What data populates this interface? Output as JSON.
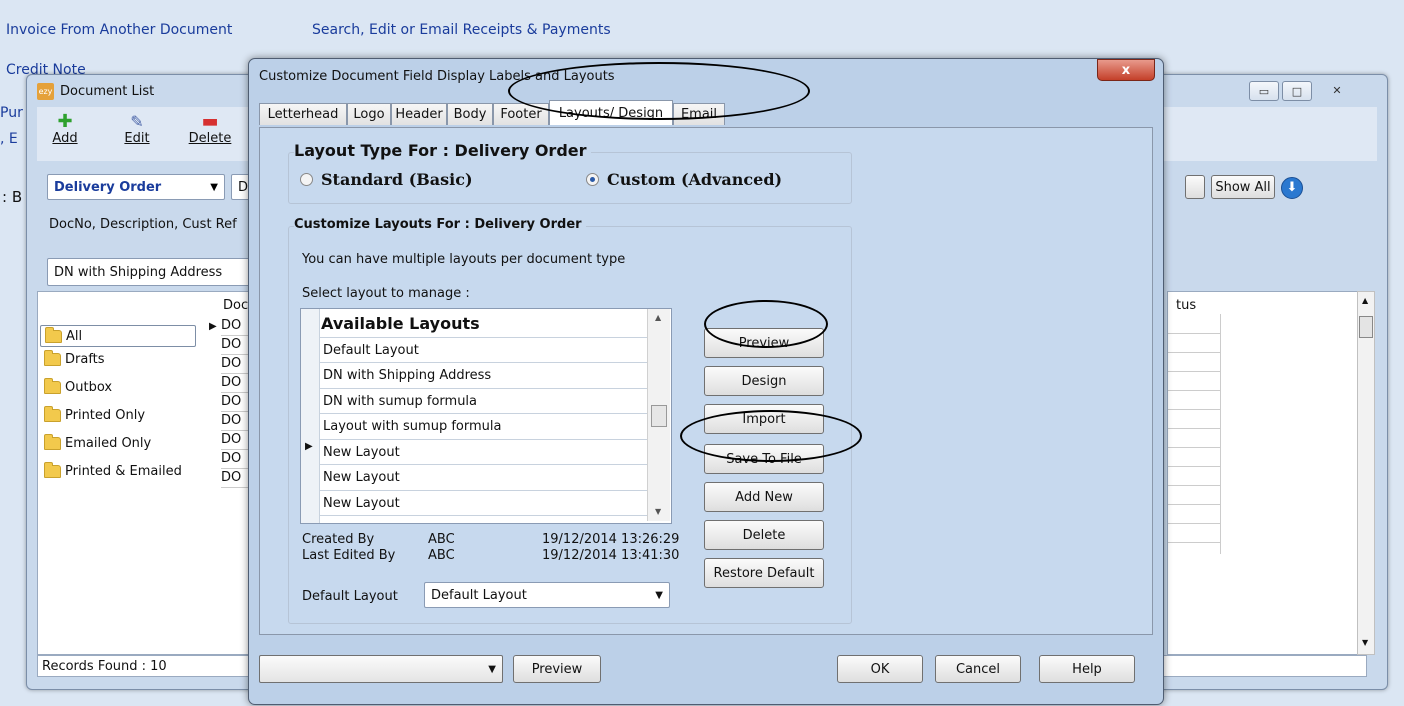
{
  "bg_links": {
    "invoice_from_doc": "Invoice From Another Document",
    "search_receipts": "Search, Edit or Email Receipts & Payments",
    "credit_note": "Credit Note",
    "pur_partial": "Pur",
    "e_partial": ", E",
    "b_partial": ": B"
  },
  "doc_list": {
    "title": "Document List",
    "toolbar": {
      "add": "Add",
      "edit": "Edit",
      "delete": "Delete"
    },
    "doc_type": "Delivery Order",
    "doc_type_partial": "D",
    "search_hint": "DocNo, Description, Cust Ref",
    "layout_select": "DN with Shipping Address",
    "show_all": "Show All",
    "folders": [
      "All",
      "Drafts",
      "Outbox",
      "Printed Only",
      "Emailed Only",
      "Printed & Emailed"
    ],
    "col_doc": "Doc",
    "col_status": "tus",
    "row_prefix": "DO",
    "records_found": "Records Found : 10"
  },
  "dialog": {
    "title": "Customize Document Field Display Labels and Layouts",
    "tabs": [
      "Letterhead",
      "Logo",
      "Header",
      "Body",
      "Footer",
      "Layouts/ Design",
      "Email"
    ],
    "layout_type_heading": "Layout Type For : Delivery Order",
    "radio_standard": "Standard (Basic)",
    "radio_custom": "Custom (Advanced)",
    "customize_heading": "Customize Layouts For : Delivery Order",
    "info_text": "You can have multiple layouts per document type",
    "select_label": "Select layout to manage :",
    "list_header": "Available Layouts",
    "layouts": [
      "Default Layout",
      "DN with Shipping Address",
      "DN with sumup formula",
      "Layout with sumup formula",
      "New Layout",
      "New Layout",
      "New Layout"
    ],
    "buttons": {
      "preview": "Preview",
      "design": "Design",
      "import": "Import",
      "save_to_file": "Save To File",
      "add_new": "Add New",
      "delete": "Delete",
      "restore_default": "Restore Default"
    },
    "created_by_label": "Created By",
    "created_by_value": "ABC",
    "created_at": "19/12/2014 13:26:29",
    "edited_by_label": "Last Edited By",
    "edited_by_value": "ABC",
    "edited_at": "19/12/2014 13:41:30",
    "default_layout_label": "Default Layout",
    "default_layout_value": "Default Layout",
    "footer": {
      "preview": "Preview",
      "ok": "OK",
      "cancel": "Cancel",
      "help": "Help",
      "close_x": "x"
    }
  }
}
